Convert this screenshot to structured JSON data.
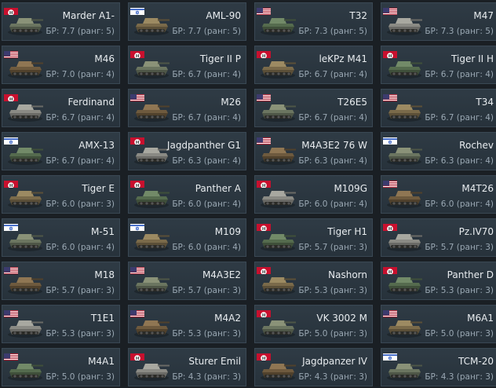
{
  "colors": {
    "background": "#1a1f24",
    "card": "#2b3740",
    "name_text": "#e8ecef",
    "br_text": "#9aa8b3"
  },
  "vehicles": [
    {
      "name": "Marder A1-",
      "br": "БР: 7.7 (ранг: 5)",
      "flag": "de"
    },
    {
      "name": "AML-90",
      "br": "БР: 7.7 (ранг: 5)",
      "flag": "il"
    },
    {
      "name": "T32",
      "br": "БР: 7.3 (ранг: 5)",
      "flag": "us"
    },
    {
      "name": "M47",
      "br": "БР: 7.3 (ранг: 5)",
      "flag": "us"
    },
    {
      "name": "M46",
      "br": "БР: 7.0 (ранг: 4)",
      "flag": "us"
    },
    {
      "name": "Tiger II P",
      "br": "БР: 6.7 (ранг: 4)",
      "flag": "de"
    },
    {
      "name": "leKPz M41",
      "br": "БР: 6.7 (ранг: 4)",
      "flag": "de"
    },
    {
      "name": "Tiger II H",
      "br": "БР: 6.7 (ранг: 4)",
      "flag": "de"
    },
    {
      "name": "Ferdinand",
      "br": "БР: 6.7 (ранг: 4)",
      "flag": "de"
    },
    {
      "name": "M26",
      "br": "БР: 6.7 (ранг: 4)",
      "flag": "us"
    },
    {
      "name": "T26E5",
      "br": "БР: 6.7 (ранг: 4)",
      "flag": "us"
    },
    {
      "name": "T34",
      "br": "БР: 6.7 (ранг: 4)",
      "flag": "us"
    },
    {
      "name": "AMX-13",
      "br": "БР: 6.7 (ранг: 4)",
      "flag": "il"
    },
    {
      "name": "Jagdpanther G1",
      "br": "БР: 6.3 (ранг: 4)",
      "flag": "de"
    },
    {
      "name": "M4A3E2 76 W",
      "br": "БР: 6.3 (ранг: 4)",
      "flag": "us"
    },
    {
      "name": "Rochev",
      "br": "БР: 6.3 (ранг: 4)",
      "flag": "il"
    },
    {
      "name": "Tiger E",
      "br": "БР: 6.0 (ранг: 3)",
      "flag": "de"
    },
    {
      "name": "Panther A",
      "br": "БР: 6.0 (ранг: 4)",
      "flag": "de"
    },
    {
      "name": "M109G",
      "br": "БР: 6.0 (ранг: 4)",
      "flag": "de"
    },
    {
      "name": "M4T26",
      "br": "БР: 6.0 (ранг: 4)",
      "flag": "us"
    },
    {
      "name": "M-51",
      "br": "БР: 6.0 (ранг: 4)",
      "flag": "il"
    },
    {
      "name": "M109",
      "br": "БР: 6.0 (ранг: 4)",
      "flag": "il"
    },
    {
      "name": "Tiger H1",
      "br": "БР: 5.7 (ранг: 3)",
      "flag": "de"
    },
    {
      "name": "Pz.IV70",
      "br": "БР: 5.7 (ранг: 3)",
      "flag": "de"
    },
    {
      "name": "M18",
      "br": "БР: 5.7 (ранг: 3)",
      "flag": "us"
    },
    {
      "name": "M4A3E2",
      "br": "БР: 5.7 (ранг: 3)",
      "flag": "us"
    },
    {
      "name": "Nashorn",
      "br": "БР: 5.3 (ранг: 3)",
      "flag": "de"
    },
    {
      "name": "Panther D",
      "br": "БР: 5.3 (ранг: 3)",
      "flag": "de"
    },
    {
      "name": "T1E1",
      "br": "БР: 5.3 (ранг: 3)",
      "flag": "us"
    },
    {
      "name": "M4A2",
      "br": "БР: 5.3 (ранг: 3)",
      "flag": "us"
    },
    {
      "name": "VK 3002 M",
      "br": "БР: 5.0 (ранг: 3)",
      "flag": "de"
    },
    {
      "name": "M6A1",
      "br": "БР: 5.0 (ранг: 3)",
      "flag": "us"
    },
    {
      "name": "M4A1",
      "br": "БР: 5.0 (ранг: 3)",
      "flag": "us"
    },
    {
      "name": "Sturer Emil",
      "br": "БР: 4.3 (ранг: 3)",
      "flag": "de"
    },
    {
      "name": "Jagdpanzer IV",
      "br": "БР: 4.3 (ранг: 3)",
      "flag": "de"
    },
    {
      "name": "TCM-20",
      "br": "БР: 4.3 (ранг: 3)",
      "flag": "il"
    }
  ]
}
